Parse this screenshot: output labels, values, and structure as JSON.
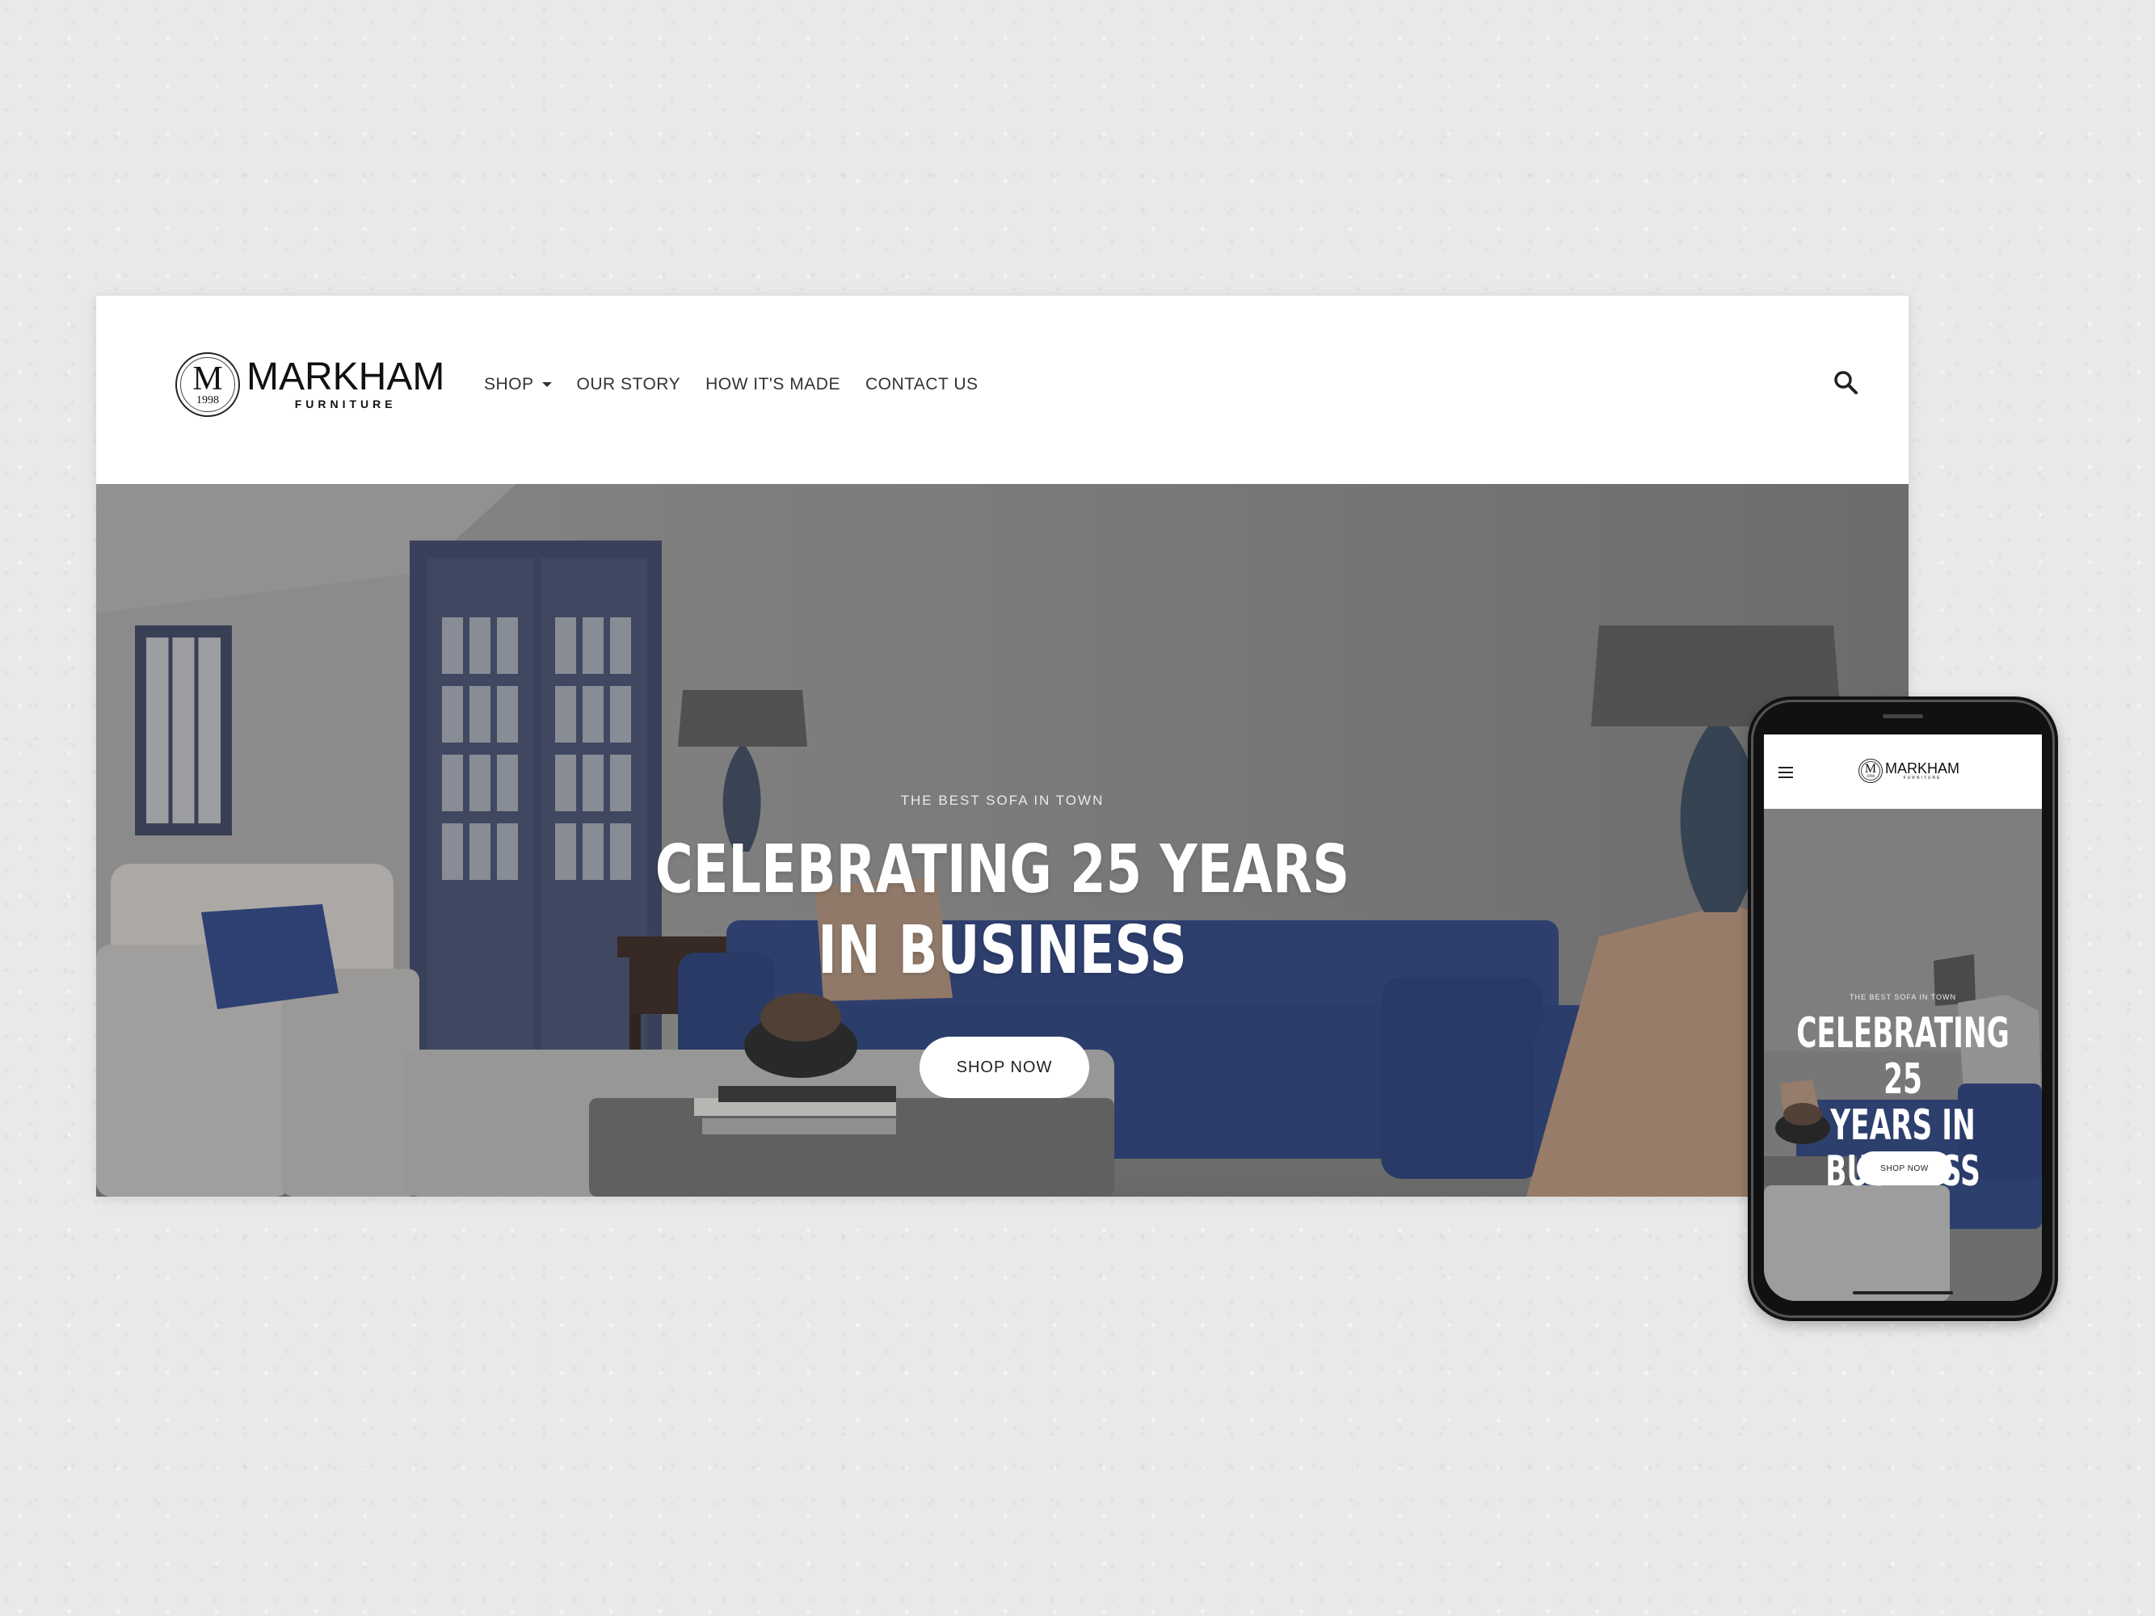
{
  "brand": {
    "seal_letter": "M",
    "seal_year": "1998",
    "name": "MARKHAM",
    "tagline": "FURNITURE"
  },
  "nav": {
    "items": [
      {
        "label": "SHOP",
        "has_dropdown": true
      },
      {
        "label": "OUR STORY"
      },
      {
        "label": "HOW IT'S MADE"
      },
      {
        "label": "CONTACT US"
      }
    ],
    "search_icon": "search-icon"
  },
  "hero": {
    "eyebrow": "THE BEST SOFA IN TOWN",
    "headline_line1": "CELEBRATING 25 YEARS",
    "headline_line2": "IN BUSINESS",
    "cta_label": "SHOP NOW"
  },
  "mobile": {
    "menu_icon": "hamburger-menu-icon",
    "eyebrow": "THE BEST SOFA IN TOWN",
    "headline_lines": [
      "CELEBRATING 25",
      "YEARS IN",
      "BUSINESS"
    ],
    "cta_label": "SHOP NOW"
  },
  "colors": {
    "page_background": "#e9e9e9",
    "header_background": "#ffffff",
    "sofa_blue": "#2f4480",
    "wall_gray": "#8c8c8c",
    "button_bg": "#ffffff",
    "text_dark": "#222222"
  }
}
